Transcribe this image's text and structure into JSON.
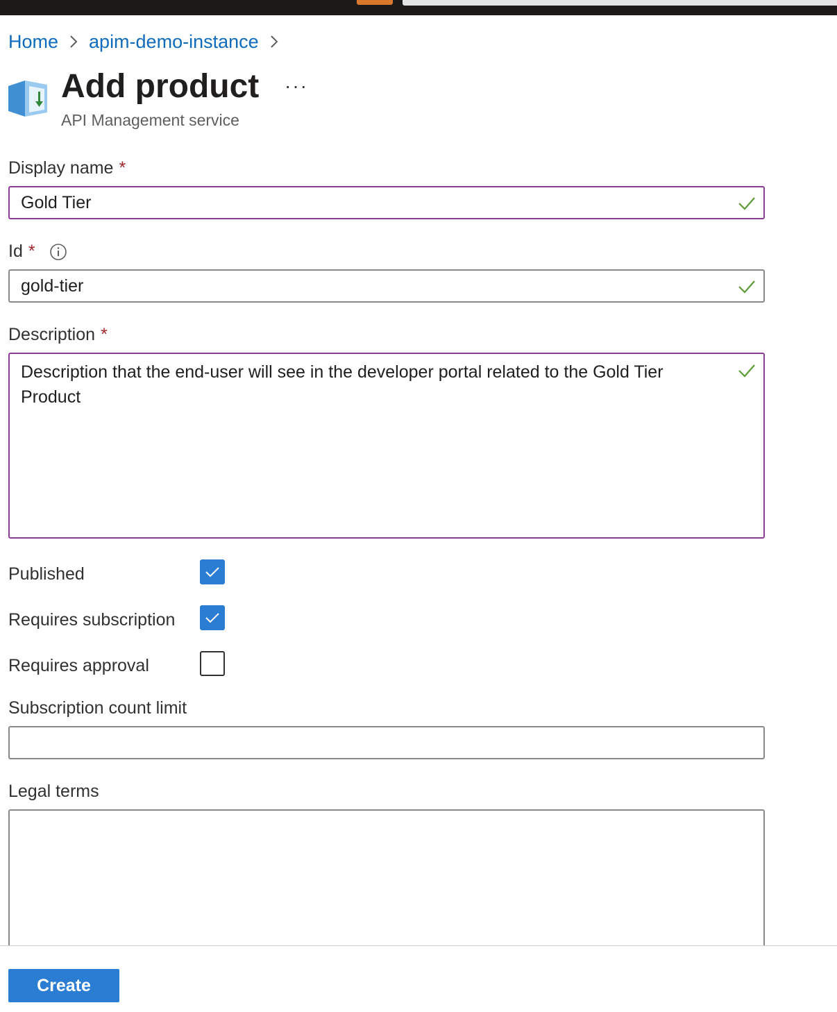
{
  "breadcrumb": {
    "items": [
      "Home",
      "apim-demo-instance"
    ]
  },
  "header": {
    "title": "Add product",
    "subtitle": "API Management service",
    "more_label": "···"
  },
  "form": {
    "display_name": {
      "label": "Display name",
      "required_mark": "*",
      "value": "Gold Tier"
    },
    "id": {
      "label": "Id",
      "required_mark": "*",
      "value": "gold-tier"
    },
    "description": {
      "label": "Description",
      "required_mark": "*",
      "value": "Description that the end-user will see in the developer portal related to the Gold Tier Product"
    },
    "published": {
      "label": "Published",
      "checked": true
    },
    "requires_subscription": {
      "label": "Requires subscription",
      "checked": true
    },
    "requires_approval": {
      "label": "Requires approval",
      "checked": false
    },
    "subscription_count_limit": {
      "label": "Subscription count limit",
      "value": ""
    },
    "legal_terms": {
      "label": "Legal terms",
      "value": ""
    }
  },
  "footer": {
    "create_label": "Create"
  },
  "colors": {
    "link": "#0f6cbd",
    "focus_border": "#8a3c97",
    "checkbox_on": "#2b7cd3",
    "required": "#a4262c",
    "valid_check": "#5b9b35"
  }
}
